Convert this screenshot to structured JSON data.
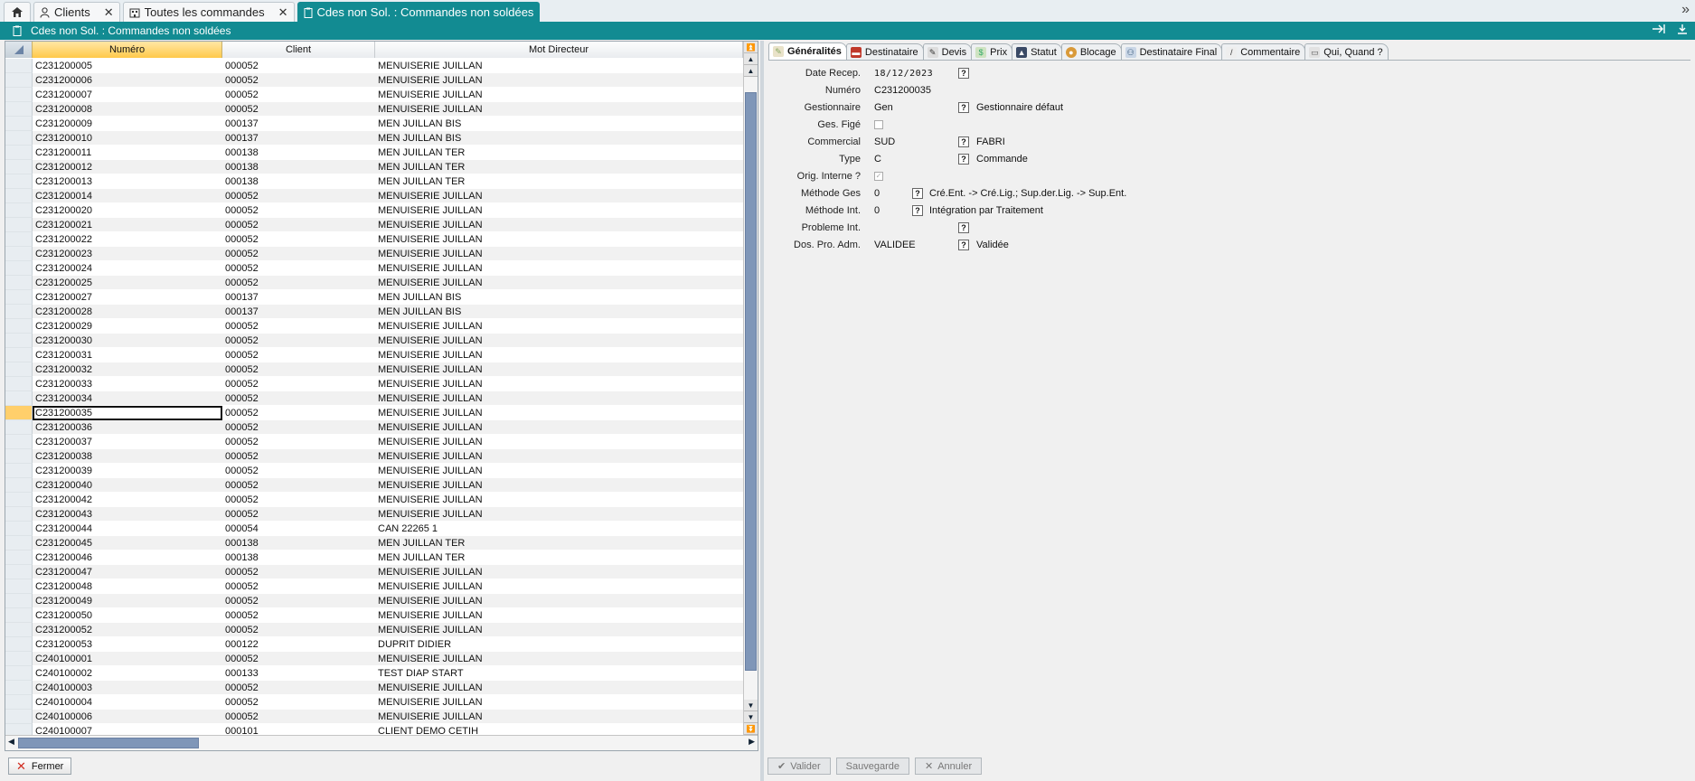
{
  "tabs": {
    "home_icon": "home-icon",
    "items": [
      {
        "label": "Clients",
        "close": "✕"
      },
      {
        "label": "Toutes les commandes",
        "close": "✕"
      },
      {
        "label": "Cdes non Sol. : Commandes non soldées"
      }
    ],
    "more": "»"
  },
  "subtitle": "Cdes non Sol. : Commandes non soldées",
  "grid": {
    "columns": [
      "Numéro",
      "Client",
      "Mot Directeur"
    ],
    "rows": [
      [
        "C231200005",
        "000052",
        "MENUISERIE JUILLAN"
      ],
      [
        "C231200006",
        "000052",
        "MENUISERIE JUILLAN"
      ],
      [
        "C231200007",
        "000052",
        "MENUISERIE JUILLAN"
      ],
      [
        "C231200008",
        "000052",
        "MENUISERIE JUILLAN"
      ],
      [
        "C231200009",
        "000137",
        "MEN JUILLAN BIS"
      ],
      [
        "C231200010",
        "000137",
        "MEN JUILLAN BIS"
      ],
      [
        "C231200011",
        "000138",
        "MEN JUILLAN TER"
      ],
      [
        "C231200012",
        "000138",
        "MEN JUILLAN TER"
      ],
      [
        "C231200013",
        "000138",
        "MEN JUILLAN TER"
      ],
      [
        "C231200014",
        "000052",
        "MENUISERIE JUILLAN"
      ],
      [
        "C231200020",
        "000052",
        "MENUISERIE JUILLAN"
      ],
      [
        "C231200021",
        "000052",
        "MENUISERIE JUILLAN"
      ],
      [
        "C231200022",
        "000052",
        "MENUISERIE JUILLAN"
      ],
      [
        "C231200023",
        "000052",
        "MENUISERIE JUILLAN"
      ],
      [
        "C231200024",
        "000052",
        "MENUISERIE JUILLAN"
      ],
      [
        "C231200025",
        "000052",
        "MENUISERIE JUILLAN"
      ],
      [
        "C231200027",
        "000137",
        "MEN JUILLAN BIS"
      ],
      [
        "C231200028",
        "000137",
        "MEN JUILLAN BIS"
      ],
      [
        "C231200029",
        "000052",
        "MENUISERIE JUILLAN"
      ],
      [
        "C231200030",
        "000052",
        "MENUISERIE JUILLAN"
      ],
      [
        "C231200031",
        "000052",
        "MENUISERIE JUILLAN"
      ],
      [
        "C231200032",
        "000052",
        "MENUISERIE JUILLAN"
      ],
      [
        "C231200033",
        "000052",
        "MENUISERIE JUILLAN"
      ],
      [
        "C231200034",
        "000052",
        "MENUISERIE JUILLAN"
      ],
      [
        "C231200035",
        "000052",
        "MENUISERIE JUILLAN"
      ],
      [
        "C231200036",
        "000052",
        "MENUISERIE JUILLAN"
      ],
      [
        "C231200037",
        "000052",
        "MENUISERIE JUILLAN"
      ],
      [
        "C231200038",
        "000052",
        "MENUISERIE JUILLAN"
      ],
      [
        "C231200039",
        "000052",
        "MENUISERIE JUILLAN"
      ],
      [
        "C231200040",
        "000052",
        "MENUISERIE JUILLAN"
      ],
      [
        "C231200042",
        "000052",
        "MENUISERIE JUILLAN"
      ],
      [
        "C231200043",
        "000052",
        "MENUISERIE JUILLAN"
      ],
      [
        "C231200044",
        "000054",
        "CAN 22265 1"
      ],
      [
        "C231200045",
        "000138",
        "MEN JUILLAN TER"
      ],
      [
        "C231200046",
        "000138",
        "MEN JUILLAN TER"
      ],
      [
        "C231200047",
        "000052",
        "MENUISERIE JUILLAN"
      ],
      [
        "C231200048",
        "000052",
        "MENUISERIE JUILLAN"
      ],
      [
        "C231200049",
        "000052",
        "MENUISERIE JUILLAN"
      ],
      [
        "C231200050",
        "000052",
        "MENUISERIE JUILLAN"
      ],
      [
        "C231200052",
        "000052",
        "MENUISERIE JUILLAN"
      ],
      [
        "C231200053",
        "000122",
        "DUPRIT DIDIER"
      ],
      [
        "C240100001",
        "000052",
        "MENUISERIE JUILLAN"
      ],
      [
        "C240100002",
        "000133",
        "TEST DIAP START"
      ],
      [
        "C240100003",
        "000052",
        "MENUISERIE JUILLAN"
      ],
      [
        "C240100004",
        "000052",
        "MENUISERIE JUILLAN"
      ],
      [
        "C240100006",
        "000052",
        "MENUISERIE JUILLAN"
      ],
      [
        "C240100007",
        "000101",
        "CLIENT DEMO CETIH"
      ]
    ],
    "selected_row": 24
  },
  "detail_tabs": [
    "Généralités",
    "Destinataire",
    "Devis",
    "Prix",
    "Statut",
    "Blocage",
    "Destinataire Final",
    "Commentaire",
    "Qui, Quand ?"
  ],
  "form": {
    "date_recep": {
      "label": "Date Recep.",
      "value": "18/12/2023",
      "help": "?"
    },
    "numero": {
      "label": "Numéro",
      "value": "C231200035"
    },
    "gestionnaire": {
      "label": "Gestionnaire",
      "value": "Gen",
      "help": "?",
      "desc": "Gestionnaire défaut"
    },
    "ges_fige": {
      "label": "Ges. Figé"
    },
    "commercial": {
      "label": "Commercial",
      "value": "SUD",
      "help": "?",
      "desc": "FABRI"
    },
    "type": {
      "label": "Type",
      "value": "C",
      "help": "?",
      "desc": "Commande"
    },
    "orig_interne": {
      "label": "Orig. Interne ?",
      "check": "✓"
    },
    "methode_ges": {
      "label": "Méthode Ges",
      "value": "0",
      "help": "?",
      "desc": "Cré.Ent. -> Cré.Lig.; Sup.der.Lig. -> Sup.Ent."
    },
    "methode_int": {
      "label": "Méthode Int.",
      "value": "0",
      "help": "?",
      "desc": "Intégration par Traitement"
    },
    "probleme_int": {
      "label": "Probleme Int.",
      "help": "?"
    },
    "dos_pro_adm": {
      "label": "Dos. Pro. Adm.",
      "value": "VALIDEE",
      "help": "?",
      "desc": "Validée"
    }
  },
  "buttons": {
    "fermer": "Fermer",
    "valider": "Valider",
    "sauvegarde": "Sauvegarde",
    "annuler": "Annuler"
  },
  "colors": {
    "teal": "#128b92",
    "header_gold": "#ffc94a",
    "scroll_thumb": "#7f96b8"
  }
}
